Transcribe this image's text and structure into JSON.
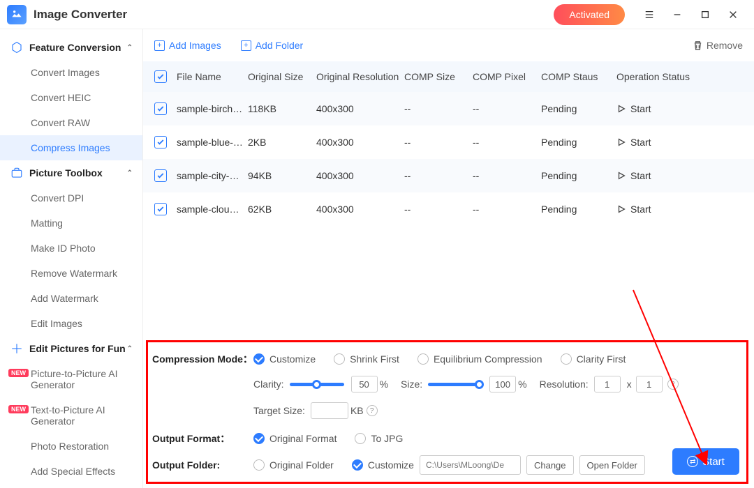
{
  "app": {
    "title": "Image Converter",
    "activated": "Activated"
  },
  "sidebar": {
    "section1": {
      "title": "Feature Conversion",
      "items": [
        "Convert Images",
        "Convert HEIC",
        "Convert RAW",
        "Compress Images"
      ]
    },
    "section2": {
      "title": "Picture Toolbox",
      "items": [
        "Convert DPI",
        "Matting",
        "Make ID Photo",
        "Remove Watermark",
        "Add Watermark",
        "Edit Images"
      ]
    },
    "section3": {
      "title": "Edit Pictures for Fun",
      "items": [
        "Picture-to-Picture AI Generator",
        "Text-to-Picture AI Generator",
        "Photo Restoration",
        "Add Special Effects"
      ]
    }
  },
  "toolbar": {
    "add_images": "Add Images",
    "add_folder": "Add Folder",
    "remove": "Remove"
  },
  "table": {
    "headers": {
      "name": "File Name",
      "osize": "Original Size",
      "ores": "Original Resolution",
      "csize": "COMP Size",
      "cpix": "COMP Pixel",
      "cstat": "COMP Staus",
      "op": "Operation Status"
    },
    "rows": [
      {
        "name": "sample-birch…",
        "osize": "118KB",
        "ores": "400x300",
        "csize": "--",
        "cpix": "--",
        "cstat": "Pending",
        "op": "Start"
      },
      {
        "name": "sample-blue-…",
        "osize": "2KB",
        "ores": "400x300",
        "csize": "--",
        "cpix": "--",
        "cstat": "Pending",
        "op": "Start"
      },
      {
        "name": "sample-city-p…",
        "osize": "94KB",
        "ores": "400x300",
        "csize": "--",
        "cpix": "--",
        "cstat": "Pending",
        "op": "Start"
      },
      {
        "name": "sample-cloud…",
        "osize": "62KB",
        "ores": "400x300",
        "csize": "--",
        "cpix": "--",
        "cstat": "Pending",
        "op": "Start"
      }
    ]
  },
  "panel": {
    "mode_label": "Compression Mode：",
    "modes": [
      "Customize",
      "Shrink First",
      "Equilibrium Compression",
      "Clarity First"
    ],
    "clarity_label": "Clarity:",
    "clarity_value": "50",
    "clarity_unit": "%",
    "size_label": "Size:",
    "size_value": "100",
    "size_unit": "%",
    "resolution_label": "Resolution:",
    "res_w": "1",
    "res_x": "x",
    "res_h": "1",
    "target_label": "Target Size:",
    "target_unit": "KB",
    "format_label": "Output Format：",
    "formats": [
      "Original Format",
      "To JPG"
    ],
    "folder_label": "Output Folder:",
    "folders": [
      "Original Folder",
      "Customize"
    ],
    "path_placeholder": "C:\\Users\\MLoong\\De",
    "change": "Change",
    "open": "Open Folder",
    "start": "Start"
  }
}
